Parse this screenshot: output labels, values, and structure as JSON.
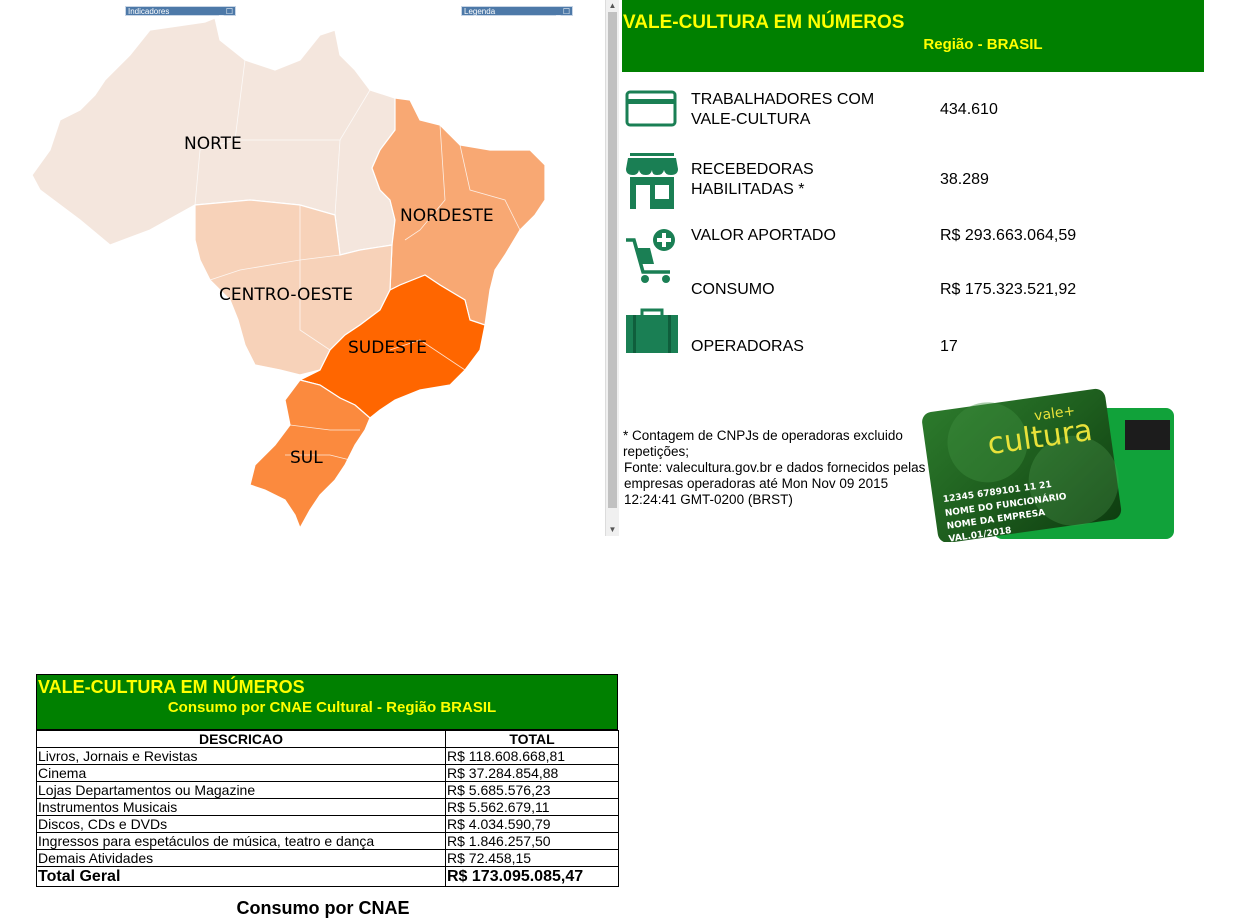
{
  "map": {
    "panel_indicators": "Indicadores",
    "panel_legend": "Legenda",
    "regions": {
      "norte": "NORTE",
      "nordeste": "NORDESTE",
      "centro_oeste": "CENTRO-OESTE",
      "sudeste": "SUDESTE",
      "sul": "SUL"
    },
    "colors": {
      "norte": "#f4e6dd",
      "nordeste": "#f8a873",
      "centro_oeste": "#f7d2b9",
      "sudeste": "#ff6600",
      "sul": "#fb8a3e"
    }
  },
  "summary": {
    "title": "VALE-CULTURA EM NÚMEROS",
    "subtitle": "Região - BRASIL",
    "header_color": "#008000",
    "title_color": "#ffff00",
    "stats": [
      {
        "icon": "credit-card-icon",
        "label": "TRABALHADORES COM VALE-CULTURA",
        "value": "434.610"
      },
      {
        "icon": "store-icon",
        "label": "RECEBEDORAS HABILITADAS *",
        "value": "38.289"
      },
      {
        "icon": "cart-add-icon",
        "label": "VALOR APORTADO",
        "value": "R$ 293.663.064,59"
      },
      {
        "icon": "",
        "label": "CONSUMO",
        "value": "R$ 175.323.521,92"
      },
      {
        "icon": "briefcase-icon",
        "label": "OPERADORAS",
        "value": "17"
      }
    ],
    "footnote": "* Contagem de CNPJs de operadoras excluido repetições;",
    "source": "Fonte: valecultura.gov.br e dados fornecidos pelas empresas operadoras até Mon Nov 09 2015 12:24:41 GMT-0200 (BRST)",
    "card": {
      "brand_top": "vale+",
      "brand": "cultura",
      "number": "12345 6789101 11 21",
      "holder": "NOME DO FUNCIONÁRIO",
      "company": "NOME DA EMPRESA",
      "validity": "VAL.01/2018"
    }
  },
  "cnae": {
    "title": "VALE-CULTURA EM NÚMEROS",
    "subtitle": "Consumo por CNAE Cultural - Região BRASIL",
    "columns": [
      "DESCRICAO",
      "TOTAL"
    ],
    "rows": [
      [
        "Livros, Jornais e Revistas",
        "R$ 118.608.668,81"
      ],
      [
        "Cinema",
        "R$ 37.284.854,88"
      ],
      [
        "Lojas Departamentos ou Magazine",
        "R$ 5.685.576,23"
      ],
      [
        "Instrumentos Musicais",
        "R$ 5.562.679,11"
      ],
      [
        "Discos, CDs e DVDs",
        "R$ 4.034.590,79"
      ],
      [
        "Ingressos para espetáculos de música, teatro e dança",
        "R$ 1.846.257,50"
      ],
      [
        "Demais Atividades",
        "R$ 72.458,15"
      ]
    ],
    "total": [
      "Total Geral",
      "R$ 173.095.085,47"
    ],
    "chart_title": "Consumo por CNAE"
  }
}
